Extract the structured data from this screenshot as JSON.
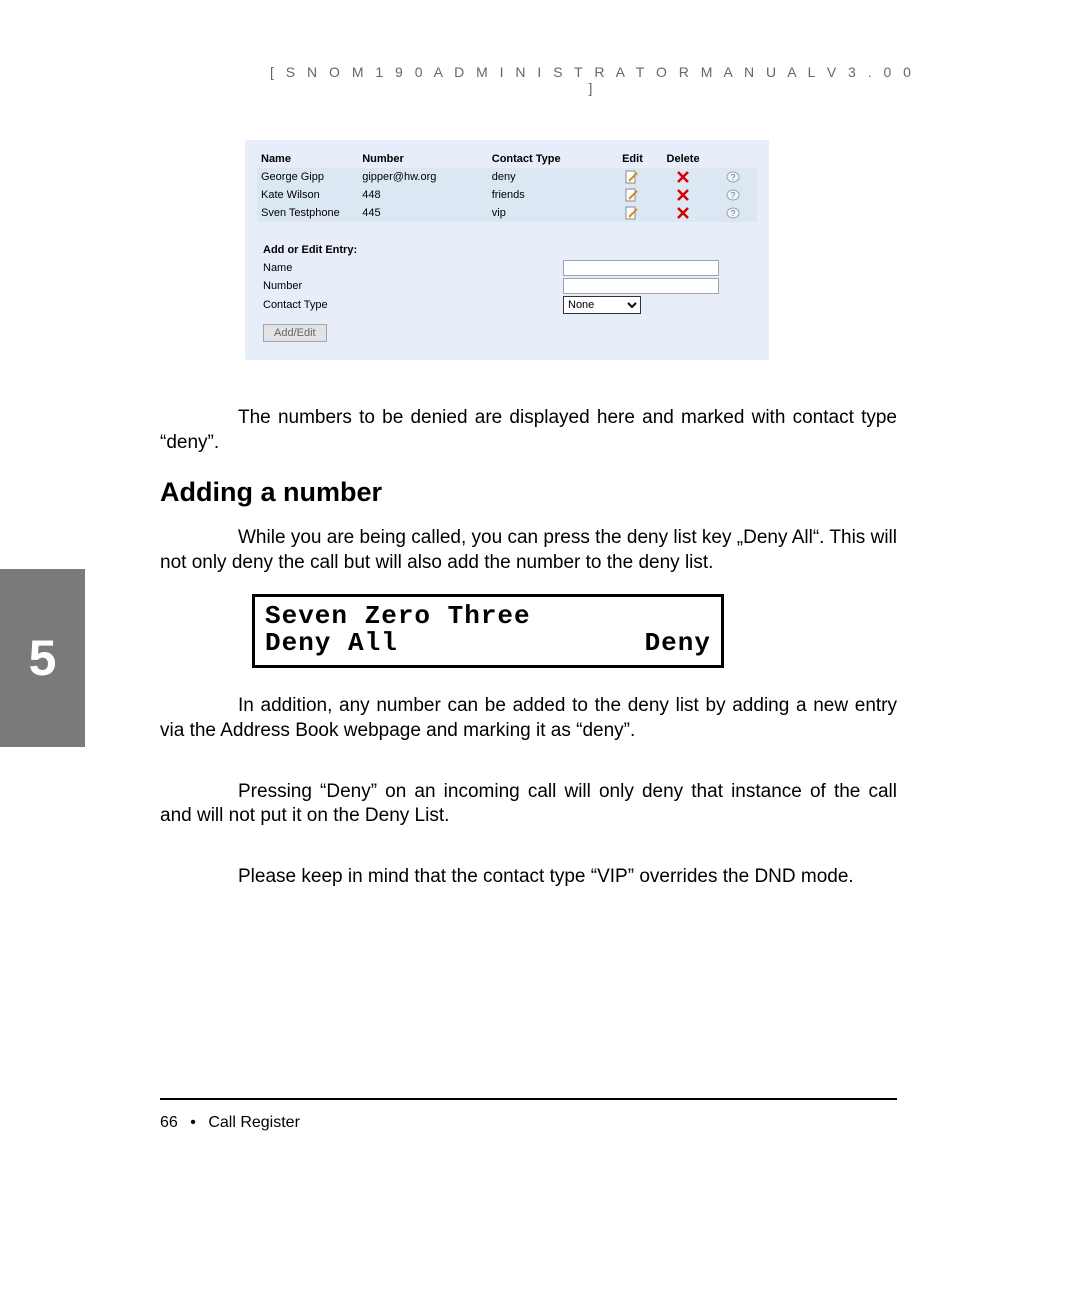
{
  "header": {
    "text": "[  S N O M   1 9 0   A D M I N I S T R A T O R   M A N U A L   V 3 . 0 0  ]"
  },
  "chapter_tab": "5",
  "address_book": {
    "columns": {
      "name": "Name",
      "number": "Number",
      "ctype": "Contact Type",
      "edit": "Edit",
      "delete": "Delete"
    },
    "rows": [
      {
        "name": "George Gipp",
        "number": "gipper@hw.org",
        "ctype": "deny"
      },
      {
        "name": "Kate Wilson",
        "number": "448",
        "ctype": "friends"
      },
      {
        "name": "Sven Testphone",
        "number": "445",
        "ctype": "vip"
      }
    ],
    "form": {
      "title": "Add or Edit Entry:",
      "name_label": "Name",
      "number_label": "Number",
      "ctype_label": "Contact Type",
      "ctype_value": "None",
      "button": "Add/Edit",
      "name_value": "",
      "number_value": ""
    }
  },
  "body": {
    "p1": "The numbers to be denied are displayed here and marked with contact type “deny”.",
    "h_add": "Adding a number",
    "p2": "While you are being called, you can press the deny list key „Deny All“. This will not only deny the call but will also add the number to the deny list.",
    "lcd": {
      "line1": "Seven Zero Three",
      "line2_left": "Deny All",
      "line2_right": "Deny"
    },
    "p3": "In addition, any number can be added to the deny list by adding a new entry via the Address Book webpage and marking it as “deny”.",
    "p4": "Pressing “Deny” on an incoming call will only deny that instance of the call and will not put it on the Deny List.",
    "p5": "Please keep in mind that the contact type “VIP” overrides the DND mode."
  },
  "footer": {
    "page": "66",
    "section": "Call Register"
  }
}
